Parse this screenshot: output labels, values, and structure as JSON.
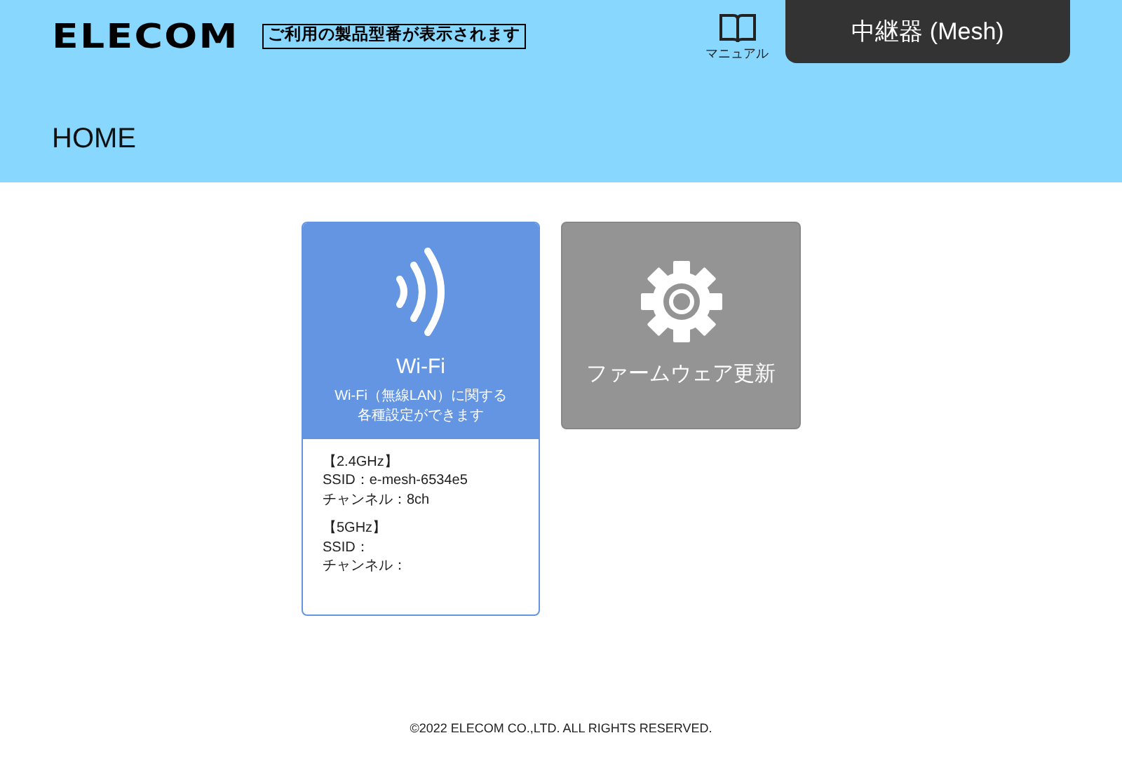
{
  "header": {
    "logo": "ELECOM",
    "model_label": "ご利用の製品型番が表示されます",
    "manual_label": "マニュアル",
    "mode_button": "中継器 (Mesh)"
  },
  "page_title": "HOME",
  "tiles": [
    {
      "kind": "wifi",
      "title": "Wi-Fi",
      "description": [
        "Wi-Fi（無線LAN）に関する",
        "各種設定ができます"
      ],
      "bands": [
        {
          "heading": "【2.4GHz】",
          "lines": [
            "SSID：e-mesh-6534e5",
            "チャンネル：8ch"
          ]
        },
        {
          "heading": "【5GHz】",
          "lines": [
            "SSID：",
            "チャンネル："
          ]
        }
      ]
    },
    {
      "kind": "firmware",
      "title": "ファームウェア更新"
    }
  ],
  "footer": "©2022 ELECOM CO.,LTD. ALL RIGHTS RESERVED."
}
